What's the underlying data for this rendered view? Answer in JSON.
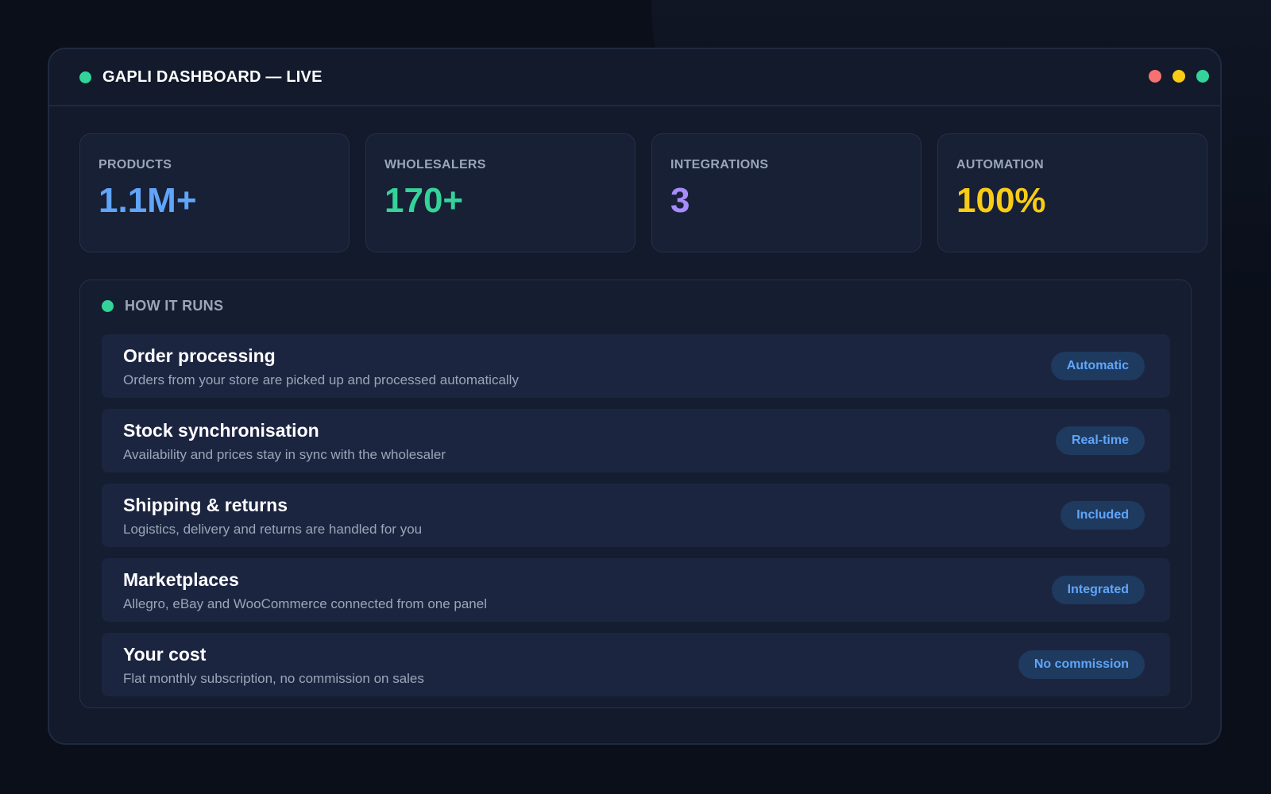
{
  "window": {
    "title": "GAPLI DASHBOARD — LIVE",
    "status": "live",
    "controls": [
      {
        "name": "close",
        "color": "#f87171"
      },
      {
        "name": "minimize",
        "color": "#facc15"
      },
      {
        "name": "maximize",
        "color": "#34d399"
      }
    ]
  },
  "stats": [
    {
      "label": "PRODUCTS",
      "value": "1.1M+",
      "color": "#60a5fa"
    },
    {
      "label": "WHOLESALERS",
      "value": "170+",
      "color": "#34d399"
    },
    {
      "label": "INTEGRATIONS",
      "value": "3",
      "color": "#a78bfa"
    },
    {
      "label": "AUTOMATION",
      "value": "100%",
      "color": "#facc15"
    }
  ],
  "runs": {
    "title": "HOW IT RUNS",
    "items": [
      {
        "title": "Order processing",
        "description": "Orders from your store are picked up and processed automatically",
        "badge": "Automatic"
      },
      {
        "title": "Stock synchronisation",
        "description": "Availability and prices stay in sync with the wholesaler",
        "badge": "Real-time"
      },
      {
        "title": "Shipping & returns",
        "description": "Logistics, delivery and returns are handled for you",
        "badge": "Included"
      },
      {
        "title": "Marketplaces",
        "description": "Allegro, eBay and WooCommerce connected from one panel",
        "badge": "Integrated"
      },
      {
        "title": "Your cost",
        "description": "Flat monthly subscription, no commission on sales",
        "badge": "No commission"
      }
    ]
  },
  "colors": {
    "accent_green": "#34d399",
    "badge_bg": "#1e3a5f",
    "badge_text": "#60a5fa"
  }
}
